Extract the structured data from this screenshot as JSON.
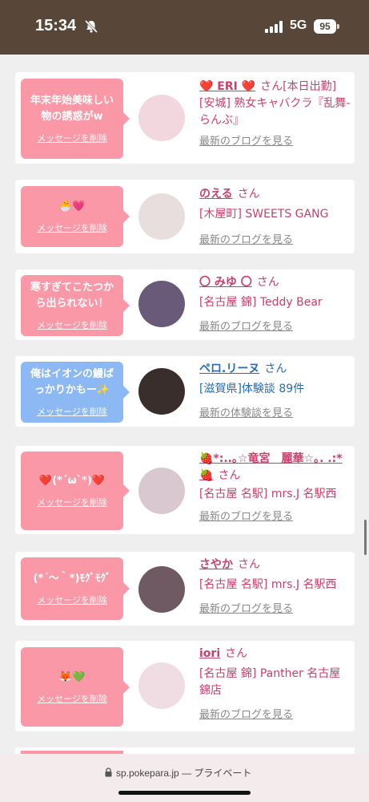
{
  "status": {
    "time": "15:34",
    "network": "5G",
    "battery": "95"
  },
  "cards": [
    {
      "message": "年末年始美味しい物の誘惑がw",
      "delete_label": "メッセージを削除",
      "name": "❤️ ERI ❤️",
      "san": "さん",
      "status": "[本日出勤]",
      "shop": "[安城] 熟女キャバクラ『乱舞-らんぶ』",
      "link": "最新のブログを見る",
      "avatar_color": "#f2d7de",
      "bubble": "pink"
    },
    {
      "message": "🐣💗",
      "delete_label": "メッセージを削除",
      "name": "のえる",
      "san": "さん",
      "status": "",
      "shop": "[木屋町] SWEETS GANG",
      "link": "最新のブログを見る",
      "avatar_color": "#e9dede",
      "bubble": "pink"
    },
    {
      "message": "寒すぎてこたつから出られない！",
      "delete_label": "メッセージを削除",
      "name": "〇 みゆ 〇",
      "san": "さん",
      "status": "",
      "shop": "[名古屋 錦] Teddy Bear",
      "link": "最新のブログを見る",
      "avatar_color": "#6a5a7a",
      "bubble": "pink"
    },
    {
      "message": "俺はイオンの鰻ばっかりかもー✨",
      "delete_label": "メッセージを削除",
      "name": "ペロ.リーヌ",
      "san": "さん",
      "status": "",
      "shop": "[滋賀県]体験談 89件",
      "link": "最新の体験談を見る",
      "avatar_color": "#3a2e2c",
      "bubble": "blue"
    },
    {
      "message": "❤️(*´ω`*)❤️",
      "delete_label": "メッセージを削除",
      "name": "🍓*:..｡☆竜宮　麗華☆｡. .:*🍓",
      "san": "さん",
      "status": "",
      "shop": "[名古屋 名駅] mrs.J 名駅西",
      "link": "最新のブログを見る",
      "avatar_color": "#d9c8cf",
      "bubble": "pink"
    },
    {
      "message": "(*´〜｀*)ﾓｸﾞﾓｸﾞ",
      "delete_label": "メッセージを削除",
      "name": "さやか",
      "san": "さん",
      "status": "",
      "shop": "[名古屋 名駅] mrs.J 名駅西",
      "link": "最新のブログを見る",
      "avatar_color": "#6f5a63",
      "bubble": "pink"
    },
    {
      "message": "🦊💚",
      "delete_label": "メッセージを削除",
      "name": "iori",
      "san": "さん",
      "status": "",
      "shop": "[名古屋 錦] Panther 名古屋錦店",
      "link": "最新のブログを見る",
      "avatar_color": "#f0dde3",
      "bubble": "pink"
    }
  ],
  "url_bar": {
    "domain": "sp.pokepara.jp",
    "suffix": "— プライベート"
  }
}
